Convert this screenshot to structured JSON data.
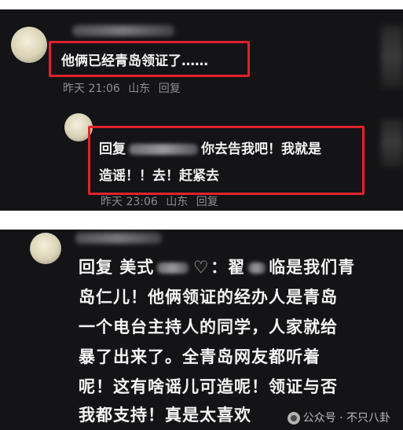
{
  "top_comment": {
    "text": "他俩已经青岛领证了……",
    "time": "昨天 21:06",
    "location": "山东",
    "reply_label": "回复"
  },
  "nested_reply": {
    "prefix": "回复",
    "line1_suffix": "你去告我吧！我就是",
    "line2": "造谣！！去！赶紧去",
    "time": "昨天 23:06",
    "location": "山东",
    "reply_label": "回复"
  },
  "second_comment": {
    "prefix": "回复 美式",
    "line1_suffix": "：翟",
    "line1_tail": "临是我们青",
    "lines": [
      "岛仁儿！他俩领证的经办人是青岛",
      "一个电台主持人的同学，人家就给",
      "暴了出来了。全青岛网友都听着",
      "呢！这有啥谣儿可造呢！领证与否",
      "我都支持！真是太喜欢"
    ]
  },
  "watermark": {
    "text": "公众号 · 不只八卦"
  },
  "colors": {
    "background": "#141416",
    "highlight_box": "#e0222c",
    "text": "#f2f2f2",
    "meta": "#8e8e93"
  }
}
